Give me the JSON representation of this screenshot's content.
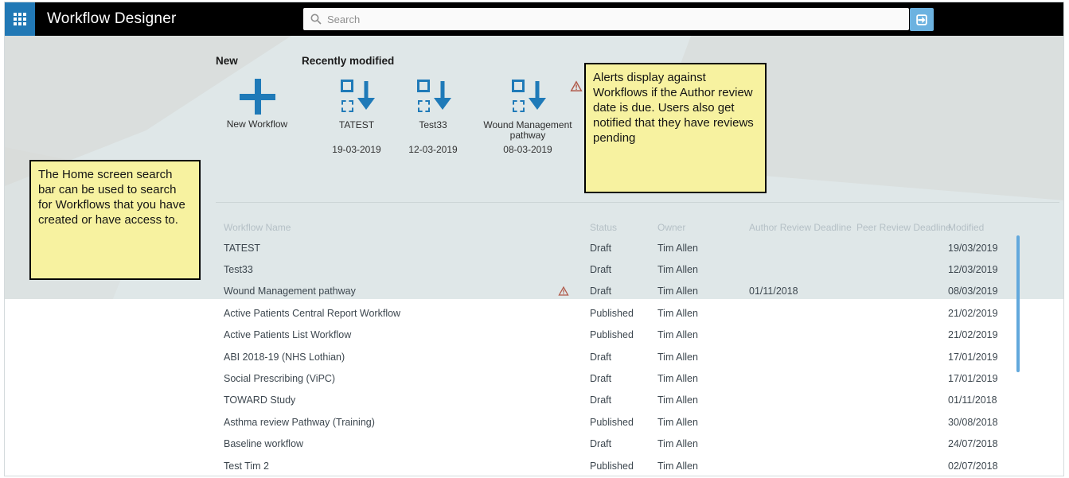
{
  "topbar": {
    "app_title": "Workflow Designer",
    "search_placeholder": "Search"
  },
  "new_section": {
    "heading": "New",
    "tile_label": "New Workflow"
  },
  "recent_section": {
    "heading": "Recently modified",
    "tiles": [
      {
        "label": "TATEST",
        "date": "19-03-2019",
        "alert": false
      },
      {
        "label": "Test33",
        "date": "12-03-2019",
        "alert": false
      },
      {
        "label": "Wound Management pathway",
        "date": "08-03-2019",
        "alert": true
      }
    ]
  },
  "notes": [
    {
      "text": "The Home screen search bar can be used to search for Workflows that you have created or have access to."
    },
    {
      "text": "Alerts display against Workflows if the Author review date is due. Users also get notified that they have reviews pending"
    }
  ],
  "table": {
    "columns": [
      "Workflow Name",
      "Status",
      "Owner",
      "Author Review Deadline",
      "Peer Review Deadline",
      "Modified"
    ],
    "rows": [
      {
        "name": "TATEST",
        "status": "Draft",
        "owner": "Tim Allen",
        "author_review": "",
        "peer_review": "",
        "modified": "19/03/2019",
        "alert": false
      },
      {
        "name": "Test33",
        "status": "Draft",
        "owner": "Tim Allen",
        "author_review": "",
        "peer_review": "",
        "modified": "12/03/2019",
        "alert": false
      },
      {
        "name": "Wound Management pathway",
        "status": "Draft",
        "owner": "Tim Allen",
        "author_review": "01/11/2018",
        "peer_review": "",
        "modified": "08/03/2019",
        "alert": true
      },
      {
        "name": "Active Patients Central Report Workflow",
        "status": "Published",
        "owner": "Tim Allen",
        "author_review": "",
        "peer_review": "",
        "modified": "21/02/2019",
        "alert": false
      },
      {
        "name": "Active Patients List Workflow",
        "status": "Published",
        "owner": "Tim Allen",
        "author_review": "",
        "peer_review": "",
        "modified": "21/02/2019",
        "alert": false
      },
      {
        "name": "ABI 2018-19 (NHS Lothian)",
        "status": "Draft",
        "owner": "Tim Allen",
        "author_review": "",
        "peer_review": "",
        "modified": "17/01/2019",
        "alert": false
      },
      {
        "name": "Social Prescribing (ViPC)",
        "status": "Draft",
        "owner": "Tim Allen",
        "author_review": "",
        "peer_review": "",
        "modified": "17/01/2019",
        "alert": false
      },
      {
        "name": "TOWARD Study",
        "status": "Draft",
        "owner": "Tim Allen",
        "author_review": "",
        "peer_review": "",
        "modified": "01/11/2018",
        "alert": false
      },
      {
        "name": "Asthma review Pathway (Training)",
        "status": "Published",
        "owner": "Tim Allen",
        "author_review": "",
        "peer_review": "",
        "modified": "30/08/2018",
        "alert": false
      },
      {
        "name": "Baseline workflow",
        "status": "Draft",
        "owner": "Tim Allen",
        "author_review": "",
        "peer_review": "",
        "modified": "24/07/2018",
        "alert": false
      },
      {
        "name": "Test Tim 2",
        "status": "Published",
        "owner": "Tim Allen",
        "author_review": "",
        "peer_review": "",
        "modified": "02/07/2018",
        "alert": false
      }
    ]
  },
  "colors": {
    "accent_blue": "#1f7ab8",
    "app_button_blue": "#2178b5",
    "go_button_blue": "#6cb2e0",
    "topbar_black": "#000000",
    "band_background": "#dfe7e8",
    "note_yellow": "#f7f2a0",
    "alert_red": "#b05a4a",
    "scrollbar_blue": "#62a8dc"
  }
}
